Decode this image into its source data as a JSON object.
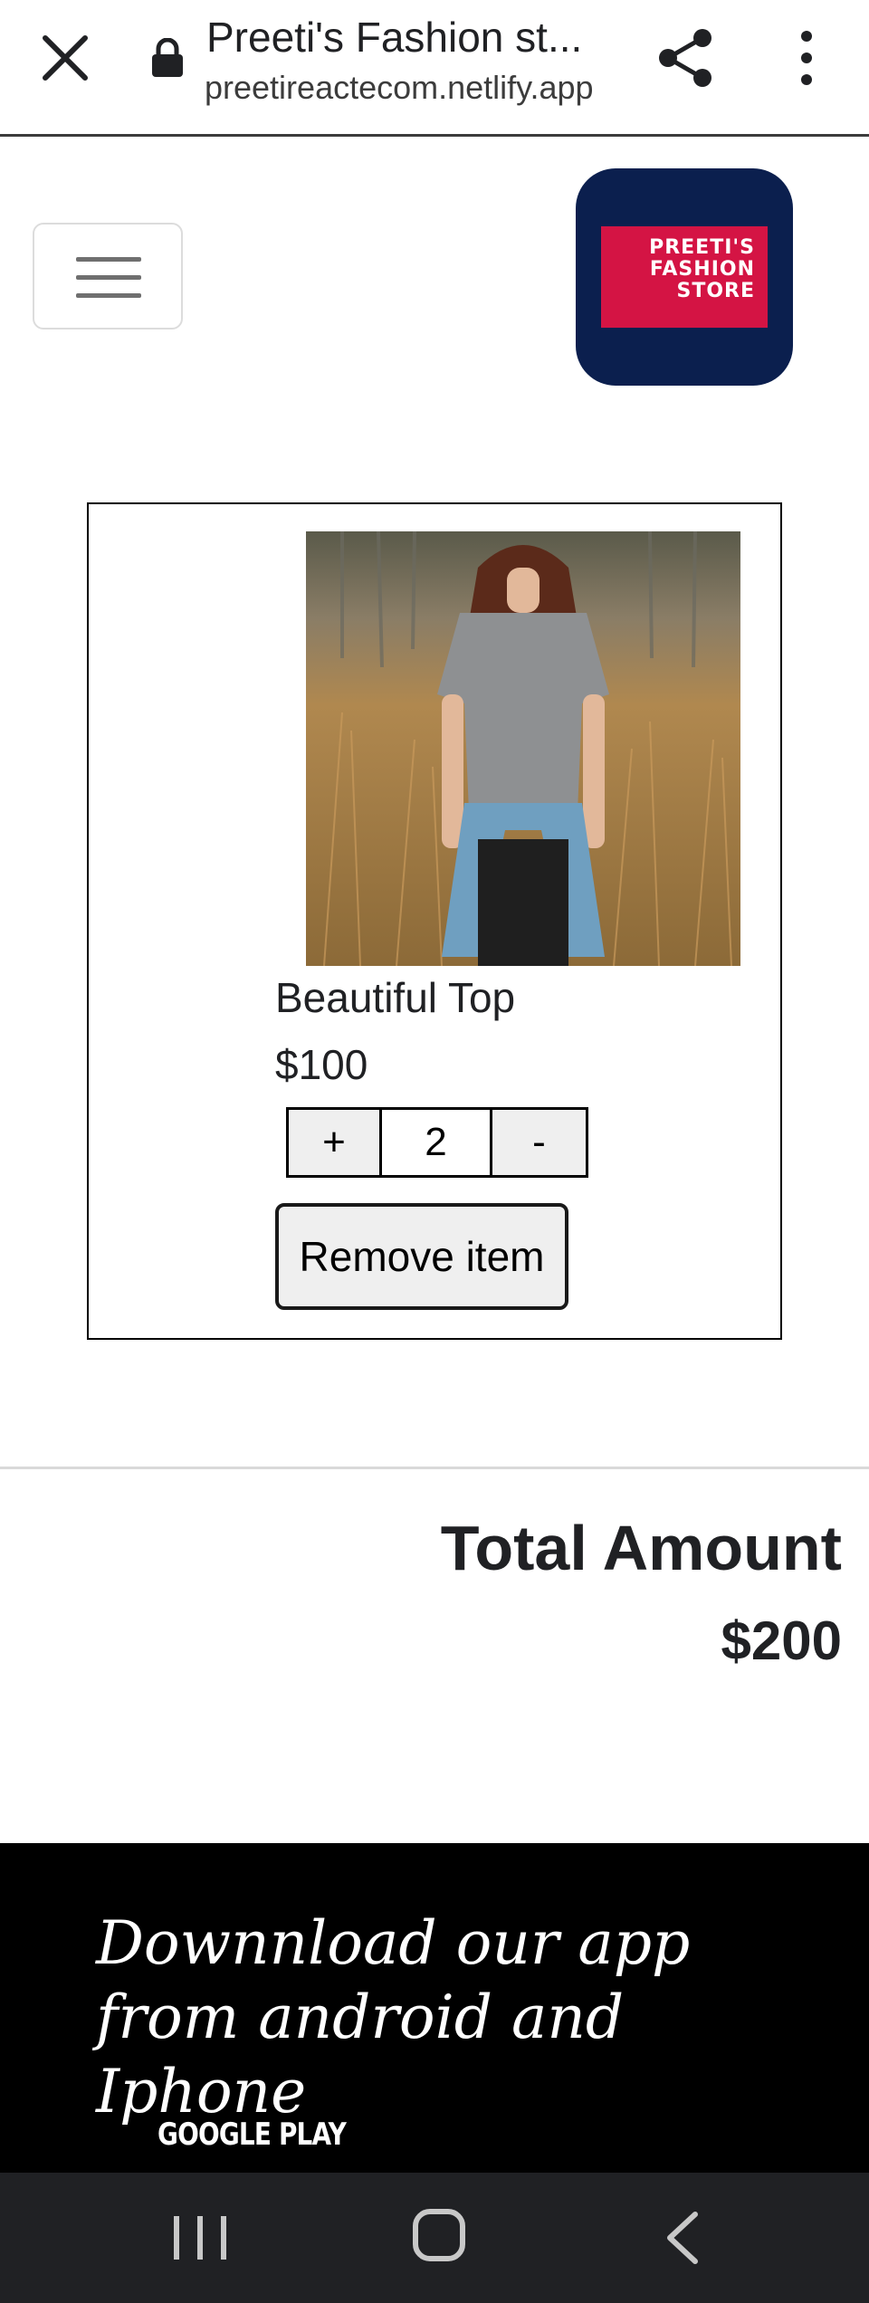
{
  "browser": {
    "title": "Preeti's Fashion st...",
    "url": "preetireactecom.netlify.app",
    "icons": {
      "close": "close-icon",
      "lock": "lock-icon",
      "share": "share-icon",
      "more": "more-vertical-icon"
    }
  },
  "header": {
    "menu_icon": "hamburger-menu-icon",
    "logo_text": "PREETI'S FASHION STORE",
    "logo_colors": {
      "background": "#0b1f4e",
      "box": "#d41444"
    }
  },
  "cart": {
    "item": {
      "name": "Beautiful Top",
      "price": "$100",
      "quantity": "2",
      "increment_label": "+",
      "decrement_label": "-",
      "remove_label": "Remove item"
    }
  },
  "summary": {
    "total_label": "Total Amount",
    "total_value": "$200"
  },
  "footer": {
    "promo_text": "Downnload our app from android and Iphone",
    "google_play_label": "GOOGLE PLAY"
  },
  "system_nav": {
    "icons": [
      "recents-icon",
      "home-icon",
      "back-icon"
    ]
  }
}
